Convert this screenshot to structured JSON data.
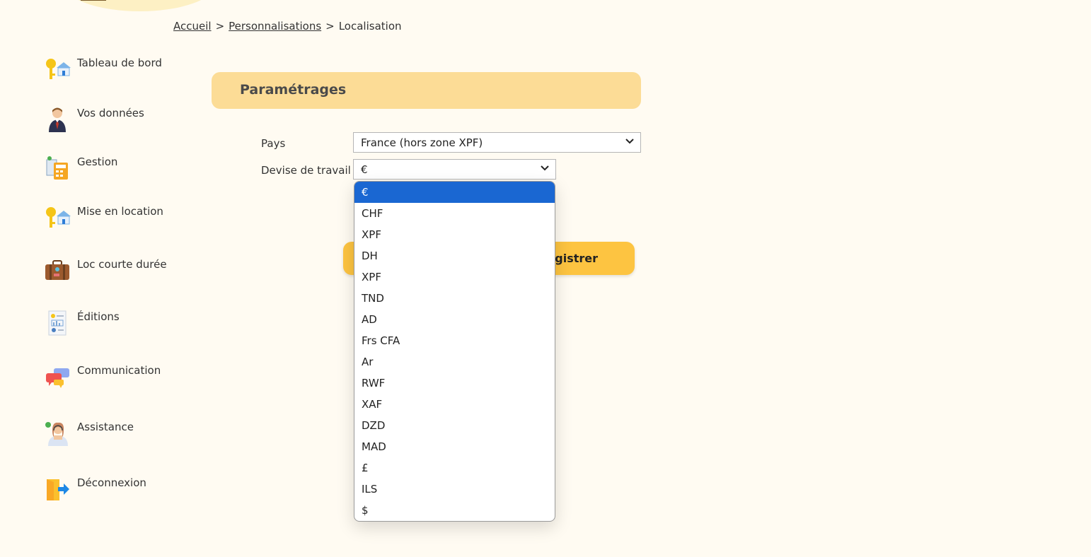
{
  "breadcrumb": {
    "home": "Accueil",
    "personalisations": "Personnalisations",
    "current": "Localisation",
    "separator": ">"
  },
  "sidebar": {
    "items": [
      {
        "label": "Tableau de bord",
        "icon": "keys-house-icon"
      },
      {
        "label": "Vos données",
        "icon": "person-icon"
      },
      {
        "label": "Gestion",
        "icon": "calculator-icon"
      },
      {
        "label": "Mise en location",
        "icon": "keys-house-icon"
      },
      {
        "label": "Loc courte durée",
        "icon": "suitcase-icon"
      },
      {
        "label": "Éditions",
        "icon": "report-icon"
      },
      {
        "label": "Communication",
        "icon": "chat-bubbles-icon"
      },
      {
        "label": "Assistance",
        "icon": "support-agent-icon"
      },
      {
        "label": "Déconnexion",
        "icon": "logout-door-icon"
      }
    ]
  },
  "panel": {
    "title": "Paramétrages"
  },
  "form": {
    "country_label": "Pays",
    "country_value": "France (hors zone XPF)",
    "currency_label": "Devise de travail",
    "currency_value": "€"
  },
  "save_button": {
    "label": "egistrer"
  },
  "currency_dropdown": {
    "options": [
      "€",
      "CHF",
      "XPF",
      "DH",
      "XPF",
      "TND",
      "AD",
      "Frs CFA",
      "Ar",
      "RWF",
      "XAF",
      "DZD",
      "MAD",
      "£",
      "ILS",
      "$"
    ],
    "selected_index": 0
  },
  "colors": {
    "background": "#fffbf2",
    "panel_header": "#fcdc96",
    "button": "#fdc441",
    "selected_option": "#1a67d2"
  }
}
